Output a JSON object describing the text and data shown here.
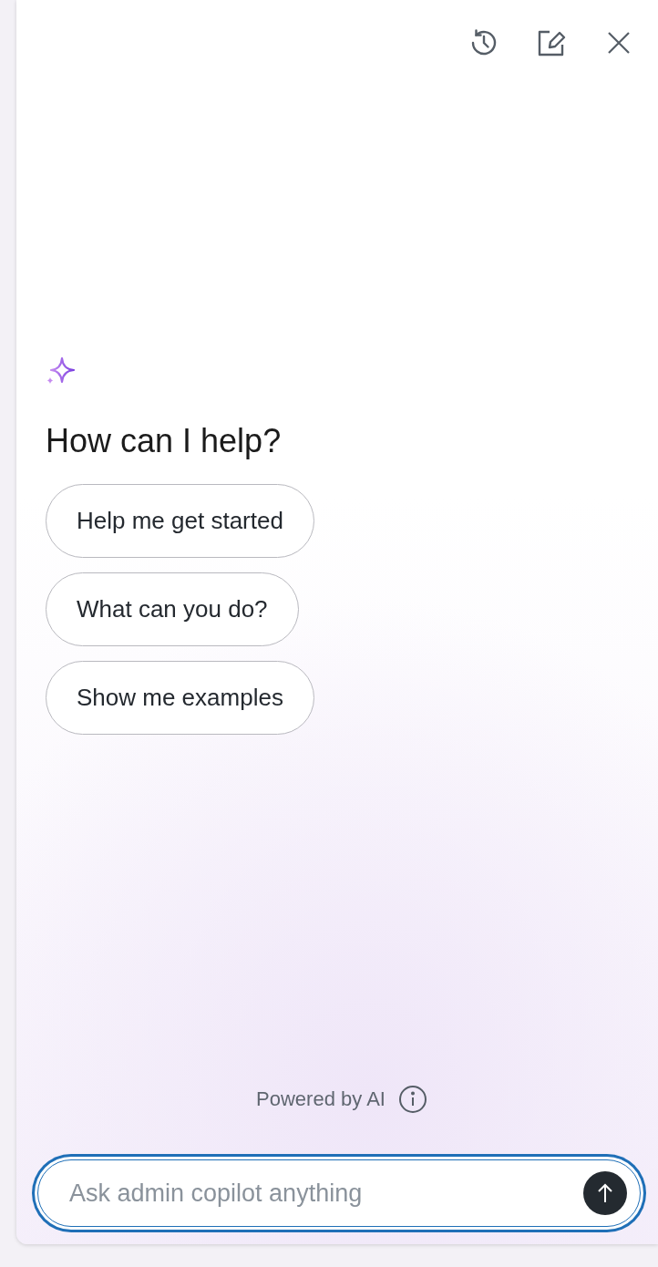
{
  "heading": "How can I help?",
  "suggestions": [
    "Help me get started",
    "What can you do?",
    "Show me examples"
  ],
  "footer": {
    "text": "Powered by AI"
  },
  "composer": {
    "placeholder": "Ask admin copilot anything"
  }
}
